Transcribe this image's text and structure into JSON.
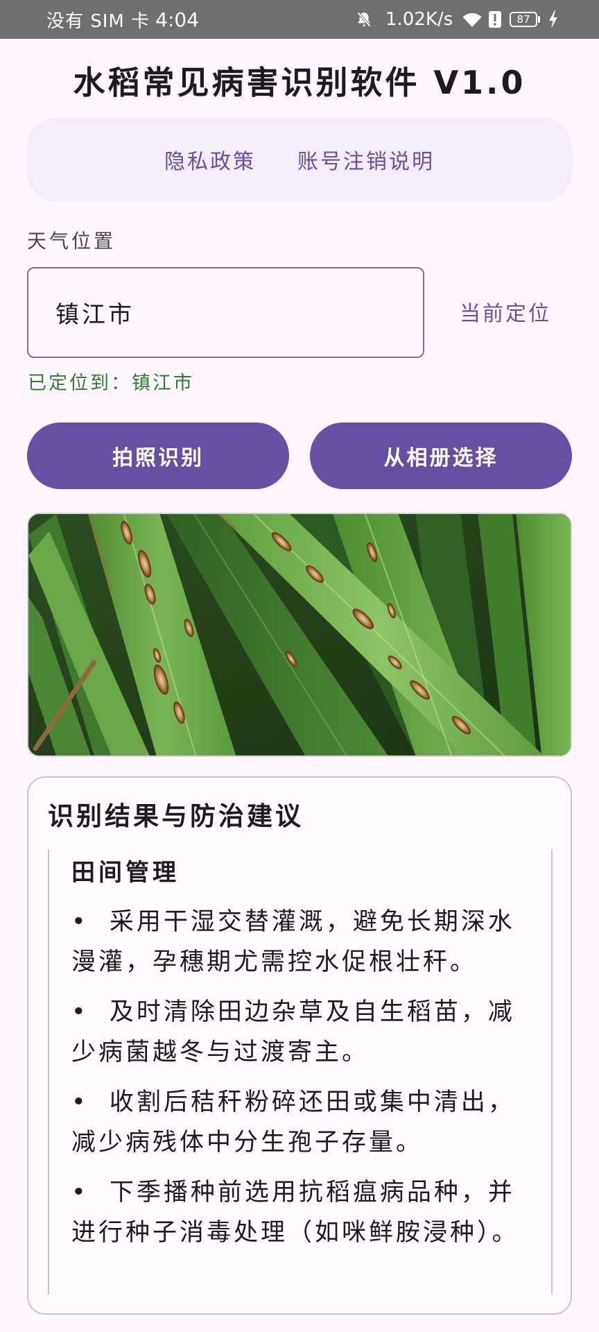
{
  "status_bar": {
    "carrier": "没有 SIM 卡",
    "time": "4:04",
    "network_speed": "1.02K/s",
    "battery_level": "87",
    "icons": [
      "notifications-off-icon",
      "wifi-icon",
      "alert-icon",
      "battery-icon",
      "charging-icon"
    ]
  },
  "header": {
    "title": "水稻常见病害识别软件 V1.0"
  },
  "links": {
    "privacy_policy": "隐私政策",
    "account_deletion": "账号注销说明"
  },
  "weather_location": {
    "label": "天气位置",
    "value": "镇江市",
    "locate_button": "当前定位",
    "status": "已定位到：镇江市"
  },
  "actions": {
    "take_photo": "拍照识别",
    "choose_from_album": "从相册选择"
  },
  "result": {
    "title": "识别结果与防治建议",
    "section": {
      "title": "田间管理",
      "items": [
        "•  采用干湿交替灌溉，避免长期深水漫灌，孕穗期尤需控水促根壮秆。",
        "•  及时清除田边杂草及自生稻苗，减少病菌越冬与过渡寄主。",
        "•  收割后秸秆粉碎还田或集中清出，减少病残体中分生孢子存量。",
        "•  下季播种前选用抗稻瘟病品种，并进行种子消毒处理（如咪鲜胺浸种）。"
      ]
    }
  },
  "theme": {
    "background": "#FEF7FF",
    "primary": "#6750A4",
    "on_primary": "#FFFFFF",
    "surface_variant": "#F3EDF7",
    "card": "#FFFBFE",
    "success": "#2E7D32",
    "outline": "#79747E",
    "divider": "#C9C4CC",
    "status_bar": "#6F6F6F",
    "text": "#1D1B20",
    "text_muted": "#49454F"
  }
}
